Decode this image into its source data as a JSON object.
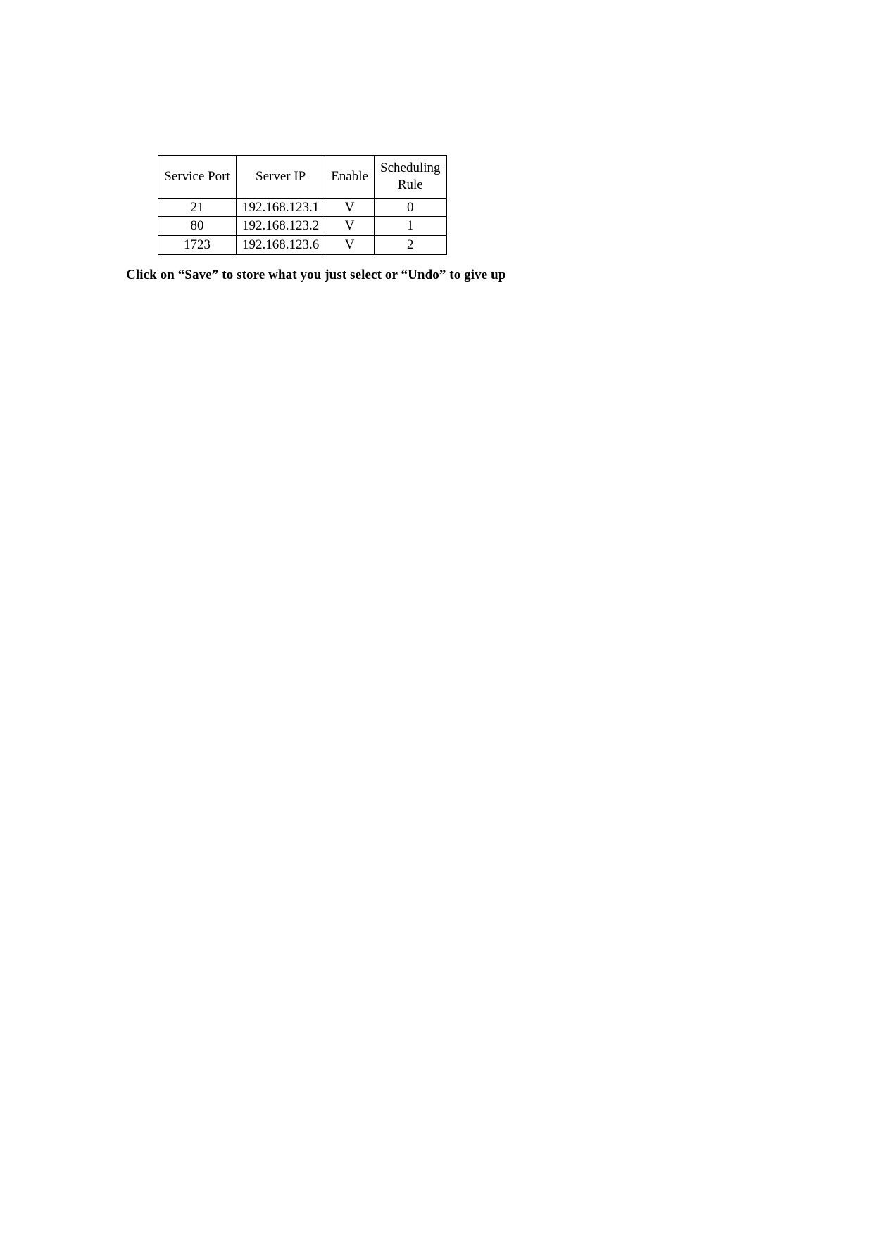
{
  "table": {
    "headers": {
      "port": "Service Port",
      "ip": "Server IP",
      "enable": "Enable",
      "rule": "Scheduling Rule"
    },
    "rows": [
      {
        "port": "21",
        "ip": "192.168.123.1",
        "enable": "V",
        "rule": "0"
      },
      {
        "port": "80",
        "ip": "192.168.123.2",
        "enable": "V",
        "rule": "1"
      },
      {
        "port": "1723",
        "ip": "192.168.123.6",
        "enable": "V",
        "rule": "2"
      }
    ]
  },
  "instruction": "Click on “Save” to store what you just select or “Undo” to give up"
}
